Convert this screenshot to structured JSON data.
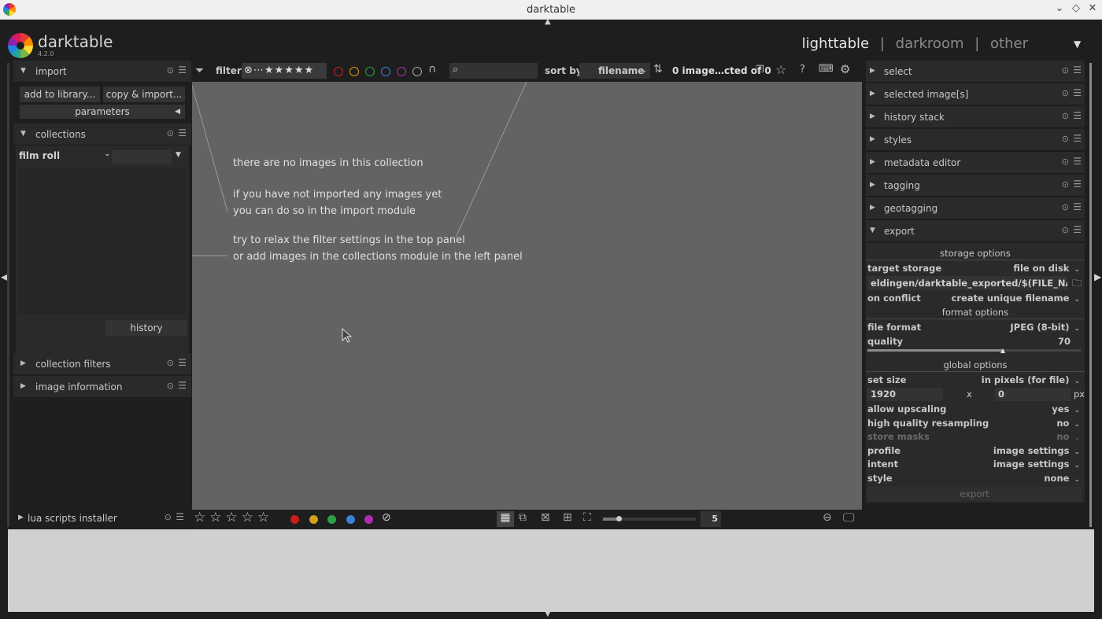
{
  "window": {
    "title": "darktable"
  },
  "app": {
    "name": "darktable",
    "version": "4.2.0"
  },
  "views": {
    "lighttable": "lighttable",
    "sep1": "|",
    "darkroom": "darkroom",
    "sep2": "|",
    "other": "other"
  },
  "left": {
    "import": {
      "label": "import",
      "add_to_library": "add to library...",
      "copy_import": "copy & import...",
      "parameters": "parameters"
    },
    "collections": {
      "label": "collections",
      "property": "film roll",
      "history": "history"
    },
    "collection_filters": "collection filters",
    "image_information": "image information",
    "lua_scripts": "lua scripts installer"
  },
  "topbar": {
    "filter_label": "filter",
    "sort_by": "sort by",
    "sort_value": "filename",
    "count": "0 image…cted of 0"
  },
  "center": {
    "msg1": "there are no images in this collection",
    "msg2": "if you have not imported any images yet",
    "msg3": "you can do so in the import module",
    "msg4": "try to relax the filter settings in the top panel",
    "msg5": "or add images in the collections module in the left panel"
  },
  "bottombar": {
    "zoom_value": "5"
  },
  "right": {
    "modules": [
      "select",
      "selected image[s]",
      "history stack",
      "styles",
      "metadata editor",
      "tagging",
      "geotagging",
      "export"
    ],
    "export": {
      "storage_options": "storage options",
      "target_storage_label": "target storage",
      "target_storage_value": "file on disk",
      "path": "eldingen/darktable_exported/$(FILE_NAME)",
      "on_conflict_label": "on conflict",
      "on_conflict_value": "create unique filename",
      "format_options": "format options",
      "file_format_label": "file format",
      "file_format_value": "JPEG (8-bit)",
      "quality_label": "quality",
      "quality_value": "70",
      "global_options": "global options",
      "set_size_label": "set size",
      "set_size_value": "in pixels (for file)",
      "width": "1920",
      "x": "x",
      "height": "0",
      "px": "px",
      "allow_upscaling_label": "allow upscaling",
      "allow_upscaling_value": "yes",
      "hq_resampling_label": "high quality resampling",
      "hq_resampling_value": "no",
      "store_masks_label": "store masks",
      "store_masks_value": "no",
      "profile_label": "profile",
      "profile_value": "image settings",
      "intent_label": "intent",
      "intent_value": "image settings",
      "style_label": "style",
      "style_value": "none",
      "export_button": "export"
    }
  },
  "colors": {
    "red": "#c81e1e",
    "yellow": "#d4a017",
    "green": "#2ea043",
    "blue": "#3b82d6",
    "purple": "#b02cb4"
  }
}
